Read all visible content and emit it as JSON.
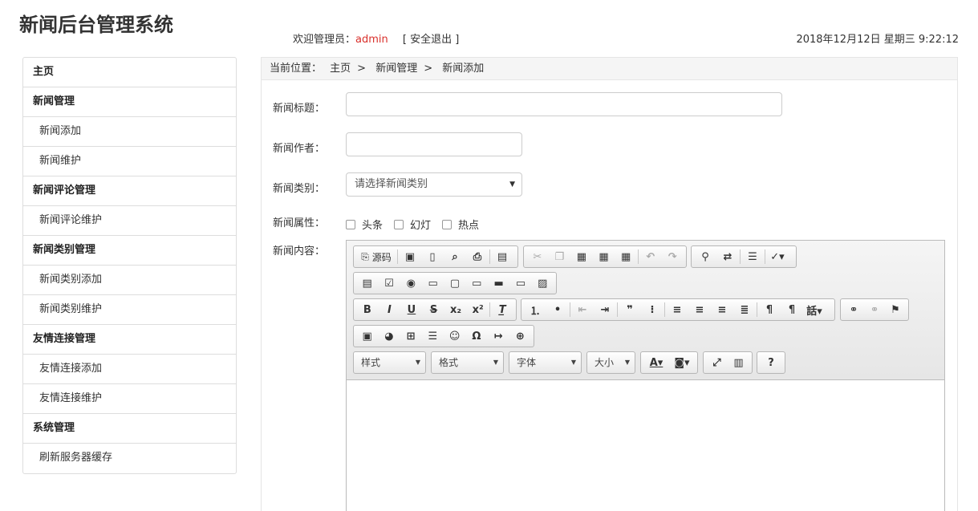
{
  "header": {
    "title": "新闻后台管理系统",
    "welcome_prefix": "欢迎管理员：",
    "username": "admin",
    "logout": "[ 安全退出 ]",
    "datetime": "2018年12月12日 星期三 9:22:12"
  },
  "sidebar": {
    "items": [
      {
        "label": "主页",
        "type": "group"
      },
      {
        "label": "新闻管理",
        "type": "group"
      },
      {
        "label": "新闻添加",
        "type": "item"
      },
      {
        "label": "新闻维护",
        "type": "item"
      },
      {
        "label": "新闻评论管理",
        "type": "group"
      },
      {
        "label": "新闻评论维护",
        "type": "item"
      },
      {
        "label": "新闻类别管理",
        "type": "group"
      },
      {
        "label": "新闻类别添加",
        "type": "item"
      },
      {
        "label": "新闻类别维护",
        "type": "item"
      },
      {
        "label": "友情连接管理",
        "type": "group"
      },
      {
        "label": "友情连接添加",
        "type": "item"
      },
      {
        "label": "友情连接维护",
        "type": "item"
      },
      {
        "label": "系统管理",
        "type": "group"
      },
      {
        "label": "刷新服务器缓存",
        "type": "item"
      }
    ]
  },
  "breadcrumb": {
    "prefix": "当前位置：",
    "crumbs": [
      "主页",
      "新闻管理",
      "新闻添加"
    ],
    "sep": ">"
  },
  "form": {
    "title_label": "新闻标题：",
    "title_value": "",
    "author_label": "新闻作者：",
    "author_value": "",
    "category_label": "新闻类别：",
    "category_selected": "请选择新闻类别",
    "attr_label": "新闻属性：",
    "attrs": [
      "头条",
      "幻灯",
      "热点"
    ],
    "content_label": "新闻内容："
  },
  "editor": {
    "source_label": "源码",
    "style_combo": "样式",
    "format_combo": "格式",
    "font_combo": "字体",
    "size_combo": "大小",
    "help_label": "?"
  }
}
